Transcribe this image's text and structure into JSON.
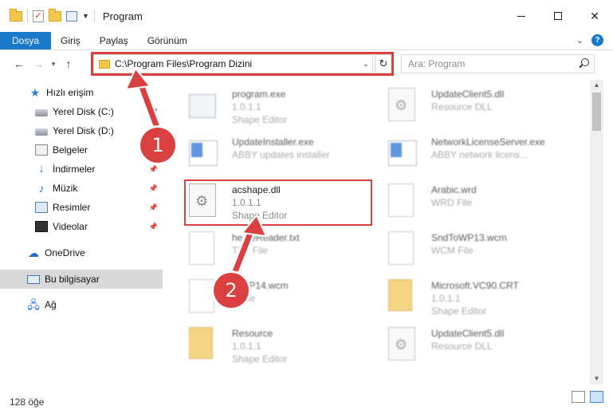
{
  "window": {
    "title": "Program"
  },
  "ribbon": {
    "tabs": [
      "Dosya",
      "Giriş",
      "Paylaş",
      "Görünüm"
    ],
    "help": "?"
  },
  "address": {
    "path": "C:\\Program Files\\Program Dizini",
    "search_placeholder": "Ara: Program"
  },
  "sidebar": {
    "items": [
      {
        "label": "Hızlı erişim",
        "icon": "star-icon"
      },
      {
        "label": "Yerel Disk (C:)",
        "icon": "disk-icon",
        "pinned": true
      },
      {
        "label": "Yerel Disk (D:)",
        "icon": "disk-icon"
      },
      {
        "label": "Belgeler",
        "icon": "documents-icon"
      },
      {
        "label": "İndirmeler",
        "icon": "download-icon",
        "pinned": true
      },
      {
        "label": "Müzik",
        "icon": "music-icon",
        "pinned": true
      },
      {
        "label": "Resimler",
        "icon": "pictures-icon",
        "pinned": true
      },
      {
        "label": "Videolar",
        "icon": "video-icon",
        "pinned": true
      },
      {
        "label": "OneDrive",
        "icon": "cloud-icon"
      },
      {
        "label": "Bu bilgisayar",
        "icon": "computer-icon",
        "selected": true
      },
      {
        "label": "Ağ",
        "icon": "network-icon"
      }
    ]
  },
  "files": [
    {
      "name": "program.exe",
      "line2": "1.0.1.1",
      "line3": "Shape Editor"
    },
    {
      "name": "UpdateClient5.dll",
      "line2": "Resource DLL",
      "line3": ""
    },
    {
      "name": "UpdateInstaller.exe",
      "line2": "ABBY updates installer",
      "line3": ""
    },
    {
      "name": "NetworkLicenseServer.exe",
      "line2": "ABBY network licens...",
      "line3": ""
    },
    {
      "name": "acshape.dll",
      "line2": "1.0.1.1",
      "line3": "Shape Editor"
    },
    {
      "name": "Arabic.wrd",
      "line2": "WRD File",
      "line3": ""
    },
    {
      "name": "he...eReader.txt",
      "line2": "TXT File",
      "line3": ""
    },
    {
      "name": "SndToWP13.wcm",
      "line2": "WCM File",
      "line3": ""
    },
    {
      "name": "...WP14.wcm",
      "line2": "...File",
      "line3": ""
    },
    {
      "name": "Microsoft.VC90.CRT",
      "line2": "1.0.1.1",
      "line3": "Shape Editor"
    },
    {
      "name": "Resource",
      "line2": "1.0.1.1",
      "line3": "Shape Editor"
    },
    {
      "name": "UpdateClient5.dll",
      "line2": "Resource DLL",
      "line3": ""
    }
  ],
  "status": {
    "count": "128 öğe"
  },
  "callouts": {
    "one": "1",
    "two": "2"
  },
  "colors": {
    "accent": "#1979ca",
    "highlight": "#d9403f"
  }
}
